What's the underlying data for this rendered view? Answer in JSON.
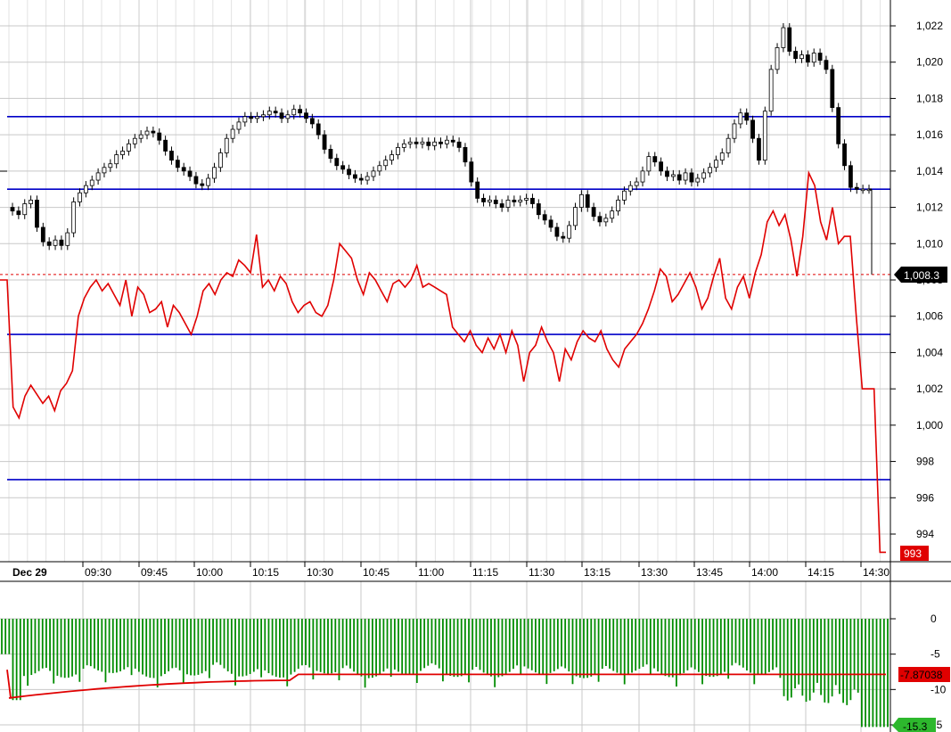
{
  "chart_data": [
    {
      "type": "candlestick+line",
      "panel": "price",
      "y_axis": {
        "range": [
          992.5,
          1022.8
        ],
        "ticks": [
          1022,
          1020,
          1018,
          1016,
          1014,
          1012,
          1010,
          1008,
          1006,
          1004,
          1002,
          1000,
          998,
          996,
          994
        ],
        "tick_labels": [
          "1,022",
          "1,020",
          "1,018",
          "1,016",
          "1,014",
          "1,012",
          "1,010",
          "1,008",
          "1,006",
          "1,004",
          "1,002",
          "1,000",
          "998",
          "996",
          "994"
        ],
        "side": "right"
      },
      "x_axis": {
        "date_label": "Dec 29",
        "tick_labels": [
          "09:30",
          "09:45",
          "10:00",
          "10:15",
          "10:30",
          "10:45",
          "11:00",
          "11:15",
          "11:30",
          "13:15",
          "13:30",
          "13:45",
          "14:00",
          "14:15",
          "14:30"
        ]
      },
      "horizontal_lines": [
        1017,
        1013,
        1005,
        997
      ],
      "reference_dotted_line": 1008.3,
      "last_price_label": "1,008.3",
      "red_line_label": "993",
      "colors": {
        "candles": "#000000",
        "red_line": "#e00000",
        "levels": "#0000c8",
        "grid": "#c8c8c8"
      },
      "candles_close": [
        1011.8,
        1011.6,
        1012.2,
        1012.4,
        1010.9,
        1010.1,
        1009.9,
        1010.2,
        1009.9,
        1010.6,
        1012.3,
        1012.8,
        1013.2,
        1013.5,
        1013.9,
        1014.2,
        1014.4,
        1014.9,
        1015.1,
        1015.5,
        1015.8,
        1016.0,
        1016.2,
        1016.1,
        1015.7,
        1015.1,
        1014.6,
        1014.2,
        1014.0,
        1013.7,
        1013.3,
        1013.2,
        1013.6,
        1014.2,
        1015.0,
        1015.8,
        1016.3,
        1016.7,
        1017.0,
        1016.9,
        1017.0,
        1017.1,
        1017.3,
        1017.2,
        1016.9,
        1017.1,
        1017.4,
        1017.2,
        1016.9,
        1016.6,
        1016.0,
        1015.2,
        1014.7,
        1014.3,
        1014.1,
        1013.8,
        1013.6,
        1013.5,
        1013.7,
        1014.0,
        1014.3,
        1014.6,
        1014.9,
        1015.3,
        1015.5,
        1015.6,
        1015.5,
        1015.6,
        1015.4,
        1015.6,
        1015.5,
        1015.7,
        1015.6,
        1015.3,
        1014.5,
        1013.4,
        1012.5,
        1012.3,
        1012.4,
        1012.2,
        1012.0,
        1012.4,
        1012.3,
        1012.4,
        1012.5,
        1012.2,
        1011.6,
        1011.3,
        1010.9,
        1010.4,
        1010.3,
        1011.0,
        1012.0,
        1012.7,
        1012.0,
        1011.5,
        1011.2,
        1011.4,
        1011.8,
        1012.4,
        1012.9,
        1013.2,
        1013.4,
        1014.0,
        1014.8,
        1014.5,
        1014.0,
        1013.7,
        1013.8,
        1013.5,
        1013.9,
        1013.4,
        1013.6,
        1013.9,
        1014.2,
        1014.6,
        1015.0,
        1015.8,
        1016.6,
        1017.2,
        1016.8,
        1015.8,
        1014.6,
        1017.3,
        1019.6,
        1020.8,
        1021.9,
        1020.6,
        1020.2,
        1020.4,
        1020.0,
        1020.5,
        1020.1,
        1019.6,
        1017.5,
        1015.5,
        1014.3,
        1013.1,
        1013.0,
        1013.0,
        1013.0
      ],
      "red_line": [
        1008.0,
        1001.0,
        1000.4,
        1001.6,
        1002.2,
        1001.7,
        1001.2,
        1001.6,
        1000.8,
        1001.9,
        1002.3,
        1003.0,
        1006.0,
        1007.0,
        1007.6,
        1008.0,
        1007.4,
        1007.8,
        1007.2,
        1006.6,
        1008.0,
        1006.0,
        1007.6,
        1007.2,
        1006.2,
        1006.4,
        1006.8,
        1005.4,
        1006.6,
        1006.2,
        1005.6,
        1005.0,
        1006.0,
        1007.4,
        1007.8,
        1007.2,
        1008.0,
        1008.4,
        1008.2,
        1009.1,
        1008.8,
        1008.4,
        1010.5,
        1007.6,
        1008.0,
        1007.4,
        1008.2,
        1007.8,
        1006.8,
        1006.2,
        1006.6,
        1006.8,
        1006.2,
        1006.0,
        1006.6,
        1008.0,
        1010.0,
        1009.6,
        1009.2,
        1008.0,
        1007.2,
        1008.4,
        1008.0,
        1007.4,
        1006.8,
        1007.8,
        1008.0,
        1007.6,
        1008.0,
        1008.8,
        1007.6,
        1007.8,
        1007.6,
        1007.4,
        1007.2,
        1005.4,
        1005.0,
        1004.6,
        1005.2,
        1004.4,
        1004.0,
        1004.8,
        1004.2,
        1005.0,
        1004.0,
        1005.2,
        1004.4,
        1002.4,
        1004.0,
        1004.4,
        1005.4,
        1004.6,
        1004.0,
        1002.4,
        1004.2,
        1003.6,
        1004.6,
        1005.2,
        1004.8,
        1004.6,
        1005.2,
        1004.2,
        1003.6,
        1003.2,
        1004.2,
        1004.6,
        1005.0,
        1005.6,
        1006.4,
        1007.4,
        1008.6,
        1008.2,
        1006.8,
        1007.2,
        1007.8,
        1008.4,
        1007.6,
        1006.4,
        1007.0,
        1008.2,
        1009.2,
        1007.0,
        1006.4,
        1007.6,
        1008.2,
        1007.0,
        1008.4,
        1009.4,
        1011.2,
        1011.8,
        1011.0,
        1011.6,
        1010.2,
        1008.2,
        1010.4,
        1013.9,
        1013.2,
        1011.2,
        1010.2,
        1012.0,
        1010.0,
        1010.4,
        1010.4,
        1006.0,
        1002.0,
        1002.0,
        1002.0,
        993.0,
        993.0
      ]
    },
    {
      "type": "bar+line",
      "panel": "oscillator",
      "y_axis": {
        "range": [
          -15,
          0
        ],
        "ticks": [
          0,
          -5,
          -10,
          -15
        ],
        "tick_labels": [
          "0",
          "-5",
          "-10",
          "15"
        ],
        "side": "right"
      },
      "line_value_label": "-7.87038",
      "last_bar_label": "-15.3",
      "colors": {
        "bars": "#008c00",
        "signal_line": "#e00000",
        "label_green": "#2db82d"
      },
      "bars_start": -5.0,
      "bars_end": -15.3,
      "line_start": -11.2,
      "line_end": -7.87038
    }
  ]
}
